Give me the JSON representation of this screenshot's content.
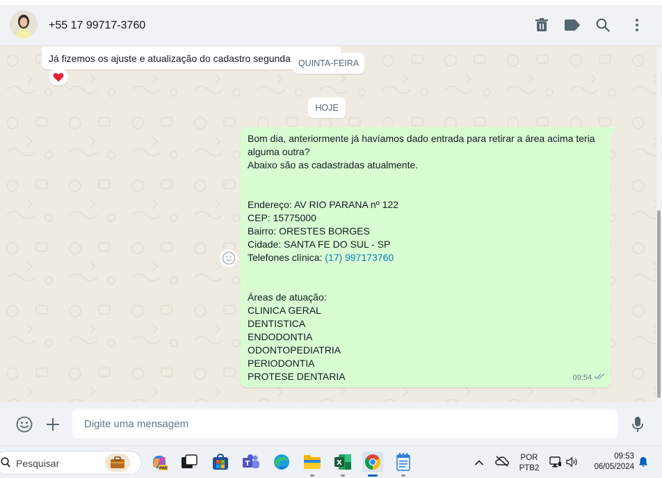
{
  "header": {
    "contact_name": "+55 17 99717-3760",
    "icons": [
      "delete-icon",
      "label-icon",
      "search-icon",
      "menu-icon"
    ]
  },
  "chat": {
    "incoming_message": {
      "text": "Já fizemos os ajuste e atualização do cadastro segunda f",
      "reaction": "❤️"
    },
    "date_chips": {
      "previous": "QUINTA-FEIRA",
      "today": "HOJE"
    },
    "outgoing_message": {
      "lines": [
        "Bom dia, anteriormente já havíamos dado entrada para retirar a área acima teria",
        "alguma outra?",
        "Abaixo são as cadastradas atualmente.",
        "",
        "",
        "Endereço: AV RIO PARANA nº 122",
        "CEP: 15775000",
        "Bairro: ORESTES BORGES",
        "Cidade: SANTA FE DO SUL - SP",
        "",
        "",
        "",
        "Áreas de atuação:",
        "CLINICA GERAL",
        "DENTISTICA",
        "ENDODONTIA",
        "ODONTOPEDIATRIA",
        "PERIODONTIA",
        "PROTESE DENTARIA"
      ],
      "phone_label": "Telefones clínica: ",
      "phone_link": "(17) 997173760",
      "time": "09:54",
      "status": "read"
    }
  },
  "composer": {
    "placeholder": "Digite uma mensagem",
    "icons": [
      "emoji-icon",
      "attach-plus-icon",
      "microphone-icon"
    ]
  },
  "taskbar": {
    "search_placeholder": "Pesquisar",
    "apps": [
      "widgets",
      "copilot",
      "task-view",
      "microsoft-store",
      "teams",
      "edge",
      "file-explorer",
      "excel",
      "chrome",
      "notepad"
    ],
    "language_line1": "POR",
    "language_line2": "PTB2",
    "time": "09:53",
    "date": "06/05/2024"
  },
  "colors": {
    "outgoing_bubble": "#d9fdd3",
    "incoming_bubble": "#ffffff",
    "chat_background": "#efeae2",
    "header_background": "#f0f2f5",
    "link": "#027eb5"
  }
}
